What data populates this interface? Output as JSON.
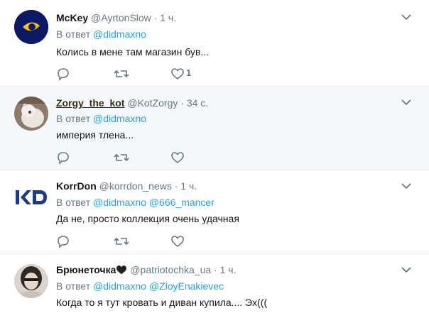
{
  "reply_prefix": "В ответ",
  "tweets": [
    {
      "name": "McKey",
      "handle": "@AyrtonSlow",
      "sep": "·",
      "time": "1 ч.",
      "mentions": [
        "@didmaxno"
      ],
      "text": "Колись в мене там магазин був...",
      "like_count": "1",
      "highlighted": false
    },
    {
      "name": "Zorgy_the_kot",
      "handle": "@KotZorgy",
      "sep": "·",
      "time": "34 с.",
      "mentions": [
        "@didmaxno"
      ],
      "text": "империя тлена...",
      "like_count": "",
      "highlighted": true
    },
    {
      "name": "KorrDon",
      "handle": "@korrdon_news",
      "sep": "·",
      "time": "1 ч.",
      "mentions": [
        "@didmaxno",
        "@666_mancer"
      ],
      "text": "Да не, просто коллекция очень удачная",
      "like_count": "",
      "highlighted": false
    },
    {
      "name": "Брюнеточка",
      "handle": "@patriotochka_ua",
      "sep": "·",
      "time": "1 ч.",
      "mentions": [
        "@didmaxno",
        "@ZloyEnakievec"
      ],
      "text": "Когда то я тут кровать и диван купила.... Эх(((",
      "like_count": "",
      "highlighted": false
    }
  ],
  "colors": {
    "accent": "#1da1f2",
    "muted": "#657786",
    "highlight_bg": "#f5f8fa"
  },
  "icons": [
    "chevron-down-icon",
    "reply-icon",
    "retweet-icon",
    "heart-icon",
    "black-heart-icon"
  ]
}
